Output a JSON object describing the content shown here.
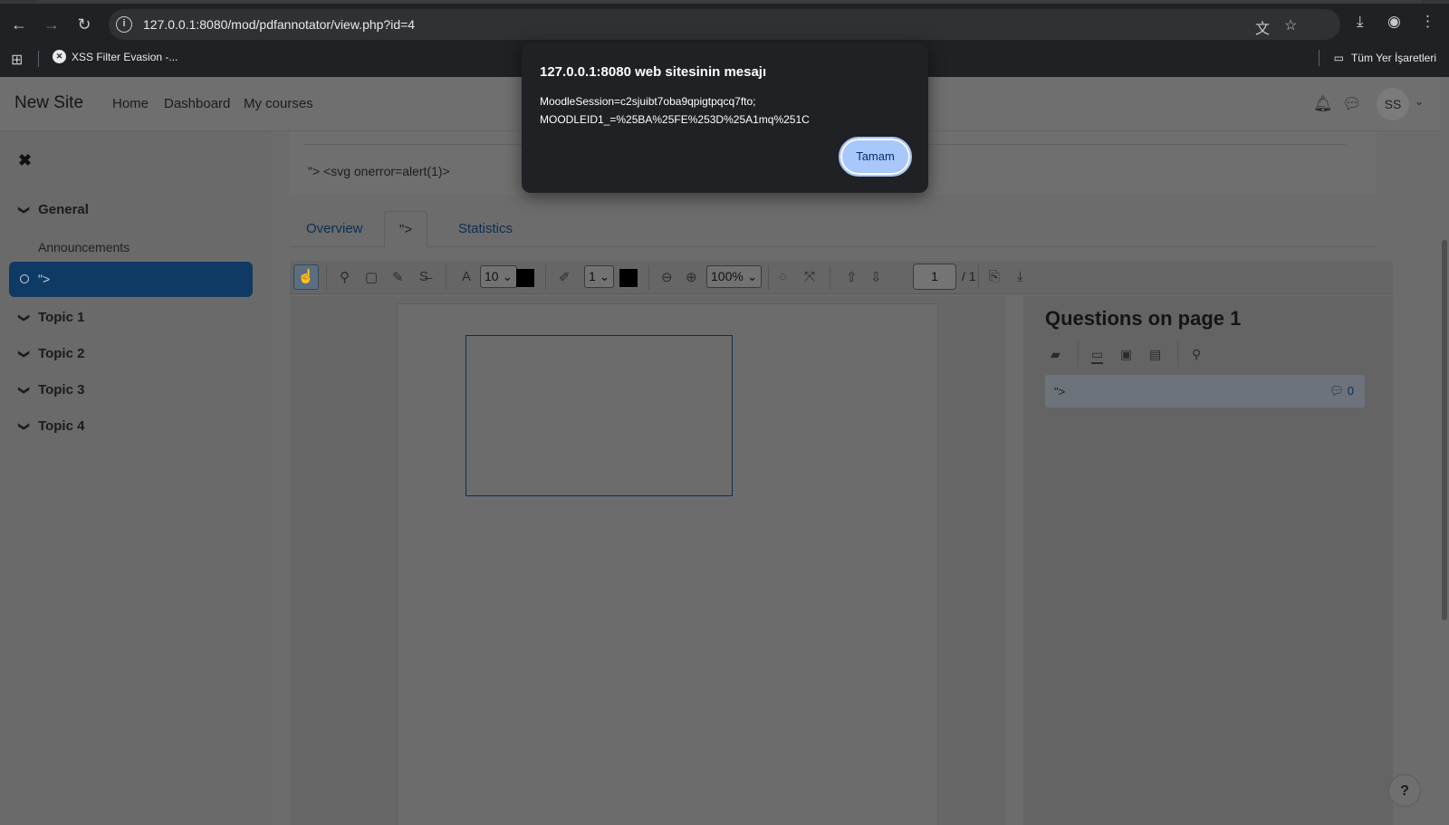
{
  "browser": {
    "url": "127.0.0.1:8080/mod/pdfannotator/view.php?id=4",
    "bookmark": "XSS Filter Evasion -...",
    "all_bookmarks": "Tüm Yer İşaretleri"
  },
  "navbar": {
    "site_name": "New Site",
    "links": [
      "Home",
      "Dashboard",
      "My courses"
    ],
    "avatar": "SS"
  },
  "drawer": {
    "sections": [
      "General",
      "Topic 1",
      "Topic 2",
      "Topic 3",
      "Topic 4"
    ],
    "activity": "Announcements",
    "active_item": "\">"
  },
  "content": {
    "description": "\"> <svg onerror=alert(1)>",
    "tabs": [
      "Overview",
      "\">",
      "Statistics"
    ]
  },
  "toolbar": {
    "font_size": "10",
    "line_width": "1",
    "zoom": "100%",
    "page": "1",
    "page_total": "/ 1"
  },
  "questions": {
    "title": "Questions on page 1",
    "item_text": "\">",
    "item_count": "0"
  },
  "dialog": {
    "title": "127.0.0.1:8080 web sitesinin mesajı",
    "line1": "MoodleSession=c2sjuibt7oba9qpigtpqcq7fto;",
    "line2": "MOODLEID1_=%25BA%25FE%253D%25A1mq%251C",
    "ok": "Tamam"
  },
  "help": "?"
}
